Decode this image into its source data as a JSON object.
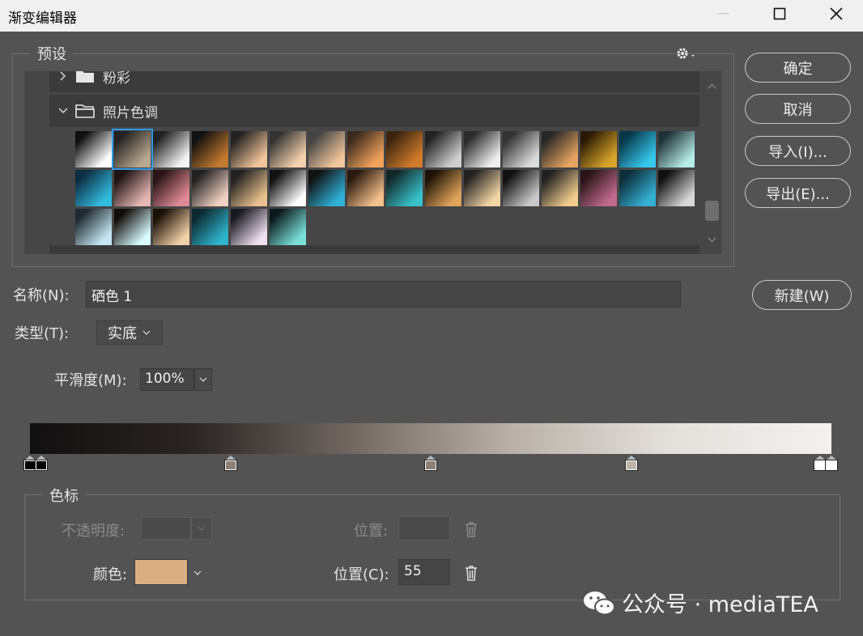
{
  "window": {
    "title": "渐变编辑器"
  },
  "presets": {
    "legend": "预设",
    "folders": [
      {
        "name": "粉彩",
        "expanded": false
      },
      {
        "name": "照片色调",
        "expanded": true
      }
    ],
    "swatches": [
      [
        "#111",
        "#fff"
      ],
      [
        "#222",
        "#b9a890"
      ],
      [
        "#222",
        "#f3f3f3"
      ],
      [
        "#111",
        "#c37a2f"
      ],
      [
        "#222",
        "#f2c49a"
      ],
      [
        "#333",
        "#f5d2ae"
      ],
      [
        "#444",
        "#f1c79c"
      ],
      [
        "#3b2b1f",
        "#f2a35b"
      ],
      [
        "#3c2510",
        "#d27c2b"
      ],
      [
        "#222",
        "#cfcfcf"
      ],
      [
        "#2b2b2b",
        "#eeeeee"
      ],
      [
        "#333",
        "#dadada"
      ],
      [
        "#272727",
        "#e6a461"
      ],
      [
        "#2a1a05",
        "#d8a52a"
      ],
      [
        "#063848",
        "#37c8ee"
      ],
      [
        "#213338",
        "#b6ece6"
      ],
      [
        "#0d2e40",
        "#33bbe0"
      ],
      [
        "#1f1313",
        "#e4b6b2"
      ],
      [
        "#2a1517",
        "#e08a95"
      ],
      [
        "#222",
        "#f0d0c2"
      ],
      [
        "#222",
        "#e8c08d"
      ],
      [
        "#111",
        "#fff"
      ],
      [
        "#111",
        "#2fb1d8"
      ],
      [
        "#2a1a10",
        "#f4c08b"
      ],
      [
        "#112828",
        "#39c1c9"
      ],
      [
        "#1d1306",
        "#e0a35a"
      ],
      [
        "#222",
        "#f3d6a5"
      ],
      [
        "#111",
        "#c9c9c9"
      ],
      [
        "#222",
        "#f2cc8e"
      ],
      [
        "#2a1518",
        "#c06a8d"
      ],
      [
        "#0e2e3a",
        "#35b0d5"
      ],
      [
        "#111",
        "#d8d8d8"
      ],
      [
        "#1f2a30",
        "#c6e6f2"
      ],
      [
        "#120c08",
        "#d7fbff"
      ],
      [
        "#1b1006",
        "#efcfa7"
      ],
      [
        "#0d2a30",
        "#2fb3cc"
      ],
      [
        "#1a1a22",
        "#f0e0f0"
      ],
      [
        "#0c1a1d",
        "#7be0d8"
      ]
    ],
    "selected_index": 1
  },
  "buttons": {
    "ok": "确定",
    "cancel": "取消",
    "import": "导入(I)...",
    "export": "导出(E)...",
    "new": "新建(W)"
  },
  "name": {
    "label": "名称(N):",
    "value": "硒色 1"
  },
  "type": {
    "label": "类型(T):",
    "value": "实底"
  },
  "smooth": {
    "label": "平滑度(M):",
    "value": "100%"
  },
  "gradient": {
    "colors": [
      "#111010",
      "#2a2423",
      "#706761",
      "#b9b1a8",
      "#e4e0dc",
      "#f3f1ef"
    ],
    "color_stops_pct": [
      0,
      25,
      50,
      75,
      100
    ]
  },
  "stops": {
    "legend": "色标",
    "opacity_label": "不透明度:",
    "position_label_1": "位置:",
    "color_label": "颜色:",
    "position_label_2": "位置(C):",
    "position_value": "55",
    "color_value": "#dcae84"
  },
  "watermark": {
    "text": "公众号 · mediaTEA"
  }
}
